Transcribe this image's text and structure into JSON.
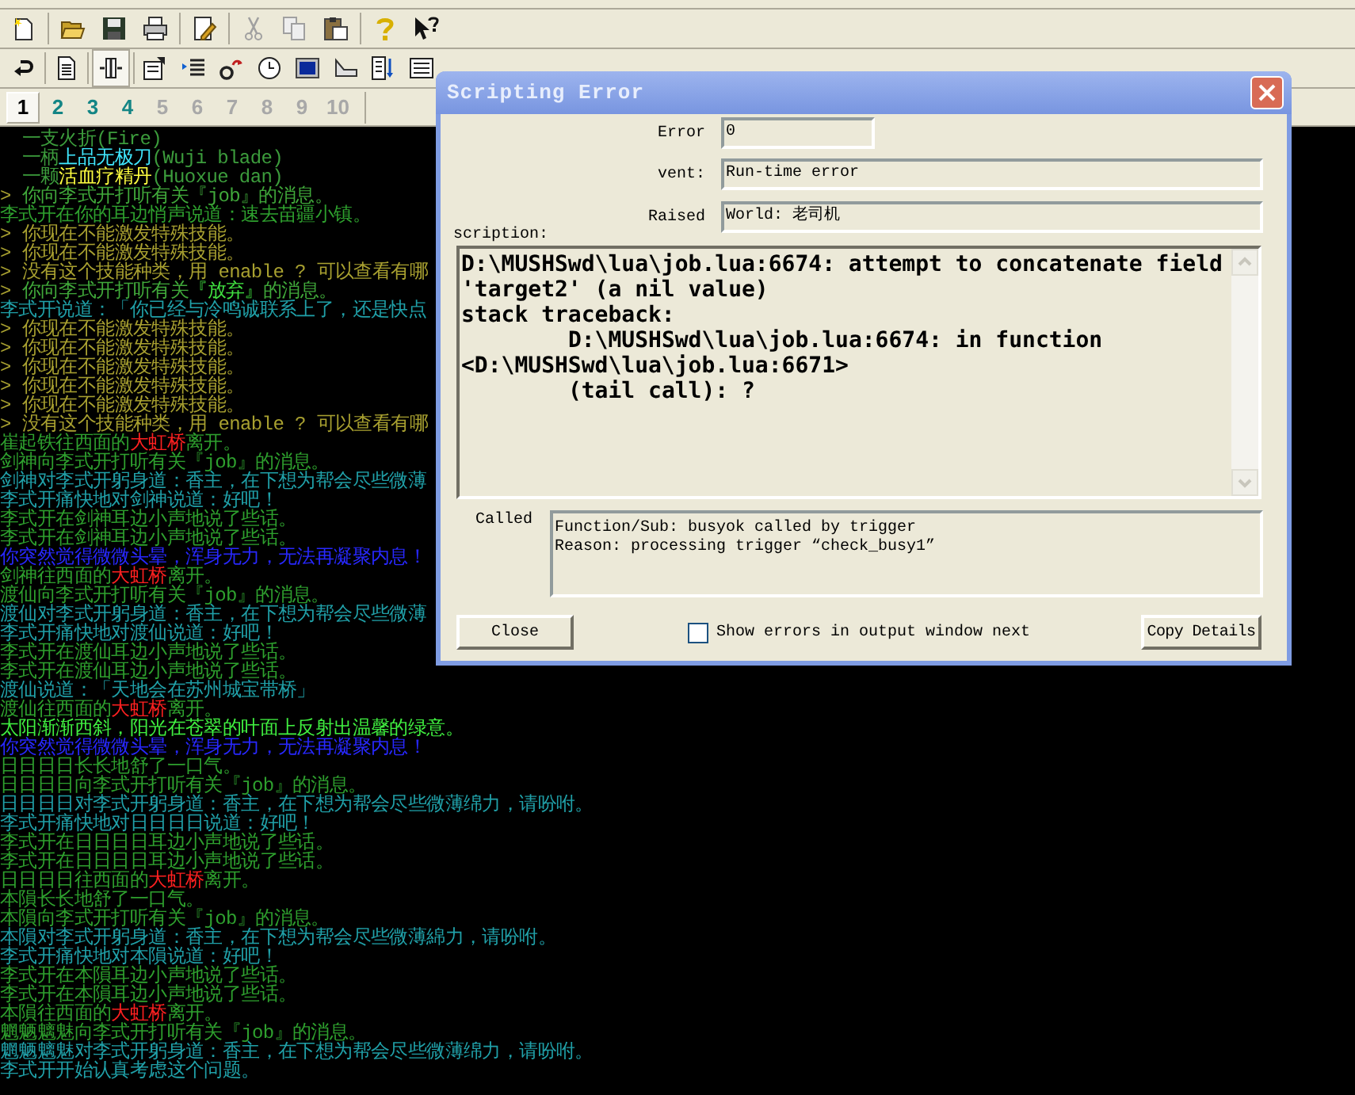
{
  "world_tabs": [
    {
      "label": "1",
      "selected": true,
      "open": true
    },
    {
      "label": "2",
      "selected": false,
      "open": true
    },
    {
      "label": "3",
      "selected": false,
      "open": true
    },
    {
      "label": "4",
      "selected": false,
      "open": true
    },
    {
      "label": "5",
      "selected": false,
      "open": false
    },
    {
      "label": "6",
      "selected": false,
      "open": false
    },
    {
      "label": "7",
      "selected": false,
      "open": false
    },
    {
      "label": "8",
      "selected": false,
      "open": false
    },
    {
      "label": "9",
      "selected": false,
      "open": false
    },
    {
      "label": "10",
      "selected": false,
      "open": false
    }
  ],
  "output_lines": [
    {
      "segments": [
        {
          "text": "  一支火折(Fire)",
          "color": "#3c9c3c"
        }
      ]
    },
    {
      "segments": [
        {
          "text": "  一柄",
          "color": "#3c9c3c"
        },
        {
          "text": "上品无极刀",
          "color": "#40e8ff"
        },
        {
          "text": "(Wuji blade)",
          "color": "#3c9c3c"
        }
      ]
    },
    {
      "segments": [
        {
          "text": "  一颗",
          "color": "#3c9c3c"
        },
        {
          "text": "活血疗精丹",
          "color": "#ffff40"
        },
        {
          "text": "(Huoxue dan)",
          "color": "#3c9c3c"
        }
      ]
    },
    {
      "segments": [
        {
          "text": "> ",
          "color": "#a8a030"
        },
        {
          "text": "你向李式开打听有关『job』的消息。",
          "color": "#40a83a"
        }
      ]
    },
    {
      "segments": [
        {
          "text": "李式开在你的耳边悄声说道：速去苗疆小镇。",
          "color": "#2ea02e"
        }
      ]
    },
    {
      "segments": [
        {
          "text": "> 你现在不能激发特殊技能。",
          "color": "#a8a030"
        }
      ]
    },
    {
      "segments": [
        {
          "text": "> 你现在不能激发特殊技能。",
          "color": "#a8a030"
        }
      ]
    },
    {
      "segments": [
        {
          "text": "> 没有这个技能种类，用 enable ? 可以查看有哪",
          "color": "#a8a030"
        }
      ]
    },
    {
      "segments": [
        {
          "text": "> ",
          "color": "#a8a030"
        },
        {
          "text": "你向李式开打听有关",
          "color": "#40a83a"
        },
        {
          "text": "『放弃』",
          "color": "#40e040"
        },
        {
          "text": "的消息。",
          "color": "#40a83a"
        }
      ]
    },
    {
      "segments": [
        {
          "text": "李式开说道：「你已经与冷鸣诚联系上了，还是快点",
          "color": "#20a0a8"
        }
      ]
    },
    {
      "segments": [
        {
          "text": "> 你现在不能激发特殊技能。",
          "color": "#a8a030"
        }
      ]
    },
    {
      "segments": [
        {
          "text": "> 你现在不能激发特殊技能。",
          "color": "#a8a030"
        }
      ]
    },
    {
      "segments": [
        {
          "text": "> 你现在不能激发特殊技能。",
          "color": "#a8a030"
        }
      ]
    },
    {
      "segments": [
        {
          "text": "> 你现在不能激发特殊技能。",
          "color": "#a8a030"
        }
      ]
    },
    {
      "segments": [
        {
          "text": "> 你现在不能激发特殊技能。",
          "color": "#a8a030"
        }
      ]
    },
    {
      "segments": [
        {
          "text": "> 没有这个技能种类，用 enable ? 可以查看有哪",
          "color": "#a8a030"
        }
      ]
    },
    {
      "segments": [
        {
          "text": "崔起铁往西面的",
          "color": "#2ea02e"
        },
        {
          "text": "大虹桥",
          "color": "#ff2020"
        },
        {
          "text": "离开。",
          "color": "#2ea02e"
        }
      ]
    },
    {
      "segments": [
        {
          "text": "剑神向李式开打听有关『job』的消息。",
          "color": "#2ea02e"
        }
      ]
    },
    {
      "segments": [
        {
          "text": "剑神对李式开躬身道：香主，在下想为帮会尽些微薄",
          "color": "#20a0a8"
        }
      ]
    },
    {
      "segments": [
        {
          "text": "李式开痛快地对剑神说道：好吧！",
          "color": "#20a0a8"
        }
      ]
    },
    {
      "segments": [
        {
          "text": "李式开在剑神耳边小声地说了些话。",
          "color": "#2ea02e"
        }
      ]
    },
    {
      "segments": [
        {
          "text": "李式开在剑神耳边小声地说了些话。",
          "color": "#2ea02e"
        }
      ]
    },
    {
      "segments": [
        {
          "text": "你突然觉得微微头晕，浑身无力，无法再凝聚内息！",
          "color": "#2828ff"
        }
      ]
    },
    {
      "segments": [
        {
          "text": "剑神往西面的",
          "color": "#2ea02e"
        },
        {
          "text": "大虹桥",
          "color": "#ff2020"
        },
        {
          "text": "离开。",
          "color": "#2ea02e"
        }
      ]
    },
    {
      "segments": [
        {
          "text": "渡仙向李式开打听有关『job』的消息。",
          "color": "#2ea02e"
        }
      ]
    },
    {
      "segments": [
        {
          "text": "渡仙对李式开躬身道：香主，在下想为帮会尽些微薄",
          "color": "#20a0a8"
        }
      ]
    },
    {
      "segments": [
        {
          "text": "李式开痛快地对渡仙说道：好吧！",
          "color": "#20a0a8"
        }
      ]
    },
    {
      "segments": [
        {
          "text": "李式开在渡仙耳边小声地说了些话。",
          "color": "#2ea02e"
        }
      ]
    },
    {
      "segments": [
        {
          "text": "李式开在渡仙耳边小声地说了些话。",
          "color": "#2ea02e"
        }
      ]
    },
    {
      "segments": [
        {
          "text": "渡仙说道：「天地会在苏州城宝带桥」",
          "color": "#20a0a8"
        }
      ]
    },
    {
      "segments": [
        {
          "text": "渡仙往西面的",
          "color": "#2ea02e"
        },
        {
          "text": "大虹桥",
          "color": "#ff2020"
        },
        {
          "text": "离开。",
          "color": "#2ea02e"
        }
      ]
    },
    {
      "segments": [
        {
          "text": "太阳渐渐西斜，阳光在苍翠的叶面上反射出温馨的绿意。",
          "color": "#40f040"
        }
      ]
    },
    {
      "segments": [
        {
          "text": "你突然觉得微微头晕，浑身无力，无法再凝聚内息！",
          "color": "#2828ff"
        }
      ]
    },
    {
      "segments": [
        {
          "text": "日日日日长长地舒了一口气。",
          "color": "#2ea02e"
        }
      ]
    },
    {
      "segments": [
        {
          "text": "日日日日向李式开打听有关『job』的消息。",
          "color": "#2ea02e"
        }
      ]
    },
    {
      "segments": [
        {
          "text": "日日日日对李式开躬身道：香主，在下想为帮会尽些微薄绵力，请吩咐。",
          "color": "#20a0a8"
        }
      ]
    },
    {
      "segments": [
        {
          "text": "李式开痛快地对日日日日说道：好吧！",
          "color": "#20a0a8"
        }
      ]
    },
    {
      "segments": [
        {
          "text": "李式开在日日日日耳边小声地说了些话。",
          "color": "#2ea02e"
        }
      ]
    },
    {
      "segments": [
        {
          "text": "李式开在日日日日耳边小声地说了些话。",
          "color": "#2ea02e"
        }
      ]
    },
    {
      "segments": [
        {
          "text": "日日日日往西面的",
          "color": "#2ea02e"
        },
        {
          "text": "大虹桥",
          "color": "#ff2020"
        },
        {
          "text": "离开。",
          "color": "#2ea02e"
        }
      ]
    },
    {
      "segments": [
        {
          "text": "本隕长长地舒了一口气。",
          "color": "#2ea02e"
        }
      ]
    },
    {
      "segments": [
        {
          "text": "本隕向李式开打听有关『job』的消息。",
          "color": "#2ea02e"
        }
      ]
    },
    {
      "segments": [
        {
          "text": "本隕对李式开躬身道：香主，在下想为帮会尽些微薄綿力，请吩咐。",
          "color": "#20a0a8"
        }
      ]
    },
    {
      "segments": [
        {
          "text": "李式开痛快地对本隕说道：好吧！",
          "color": "#20a0a8"
        }
      ]
    },
    {
      "segments": [
        {
          "text": "李式开在本隕耳边小声地说了些话。",
          "color": "#2ea02e"
        }
      ]
    },
    {
      "segments": [
        {
          "text": "李式开在本隕耳边小声地说了些话。",
          "color": "#2ea02e"
        }
      ]
    },
    {
      "segments": [
        {
          "text": "本隕往西面的",
          "color": "#2ea02e"
        },
        {
          "text": "大虹桥",
          "color": "#ff2020"
        },
        {
          "text": "离开。",
          "color": "#2ea02e"
        }
      ]
    },
    {
      "segments": [
        {
          "text": "魍魉魑魅向李式开打听有关『job』的消息。",
          "color": "#2ea02e"
        }
      ]
    },
    {
      "segments": [
        {
          "text": "魍魉魑魅对李式开躬身道：香主，在下想为帮会尽些微薄绵力，请吩咐。",
          "color": "#20a0a8"
        }
      ]
    },
    {
      "segments": [
        {
          "text": "李式开开始认真考虑这个问题。",
          "color": "#20a0a8"
        }
      ]
    }
  ],
  "dialog": {
    "title": "Scripting Error",
    "fields": [
      {
        "label": "Error",
        "value": "0",
        "kind": "short"
      },
      {
        "label": "vent:",
        "value": "Run-time error",
        "kind": "wide"
      },
      {
        "label": "Raised",
        "value": "World: 老司机",
        "kind": "wide"
      }
    ],
    "description_label": "scription:",
    "description_lines": [
      "D:\\MUSHSwd\\lua\\job.lua:6674: attempt to concatenate field",
      "'target2' (a nil value)",
      "stack traceback:",
      "\tD:\\MUSHSwd\\lua\\job.lua:6674: in function",
      "<D:\\MUSHSwd\\lua\\job.lua:6671>",
      "\t(tail call): ?"
    ],
    "called_label": "Called",
    "called_lines": [
      "Function/Sub: busyok called by trigger",
      "Reason: processing trigger “check_busy1”"
    ],
    "close_button": "Close",
    "show_errors_checkbox": {
      "label": "Show errors in output window next",
      "checked": false
    },
    "copy_button": "Copy Details"
  }
}
